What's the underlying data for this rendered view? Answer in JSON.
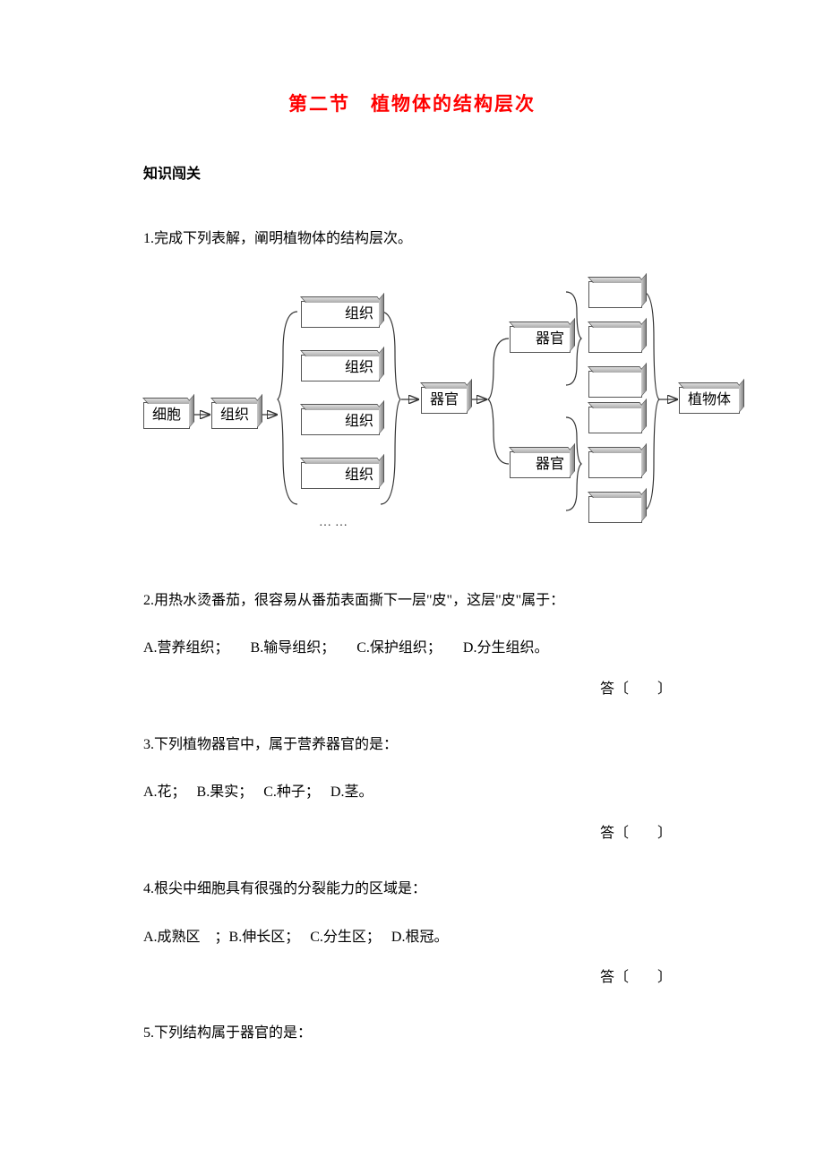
{
  "title": "第二节　植物体的结构层次",
  "section_heading": "知识闯关",
  "diagram": {
    "n_cell": "细胞",
    "n_tissue": "组织",
    "n_tissue1": "组织",
    "n_tissue2": "组织",
    "n_tissue3": "组织",
    "n_tissue4": "组织",
    "n_organ": "器官",
    "n_organ1": "器官",
    "n_organ2": "器官",
    "n_plant": "植物体",
    "dots": "……"
  },
  "q1": {
    "text": "1.完成下列表解，阐明植物体的结构层次。"
  },
  "q2": {
    "text": "2.用热水烫番茄，很容易从番茄表面撕下一层\"皮\"，这层\"皮\"属于：",
    "options": "A.营养组织；　　B.输导组织；　　C.保护组织；　　D.分生组织。",
    "answer": "答〔　　〕"
  },
  "q3": {
    "text": "3.下列植物器官中，属于营养器官的是：",
    "options": "A.花；　 B.果实；　 C.种子；　 D.茎。",
    "answer": "答〔　　〕"
  },
  "q4": {
    "text": "4.根尖中细胞具有很强的分裂能力的区域是：",
    "options": "A.成熟区　；B.伸长区；　 C.分生区；　 D.根冠。",
    "answer": "答〔　　〕"
  },
  "q5": {
    "text": "5.下列结构属于器官的是："
  }
}
